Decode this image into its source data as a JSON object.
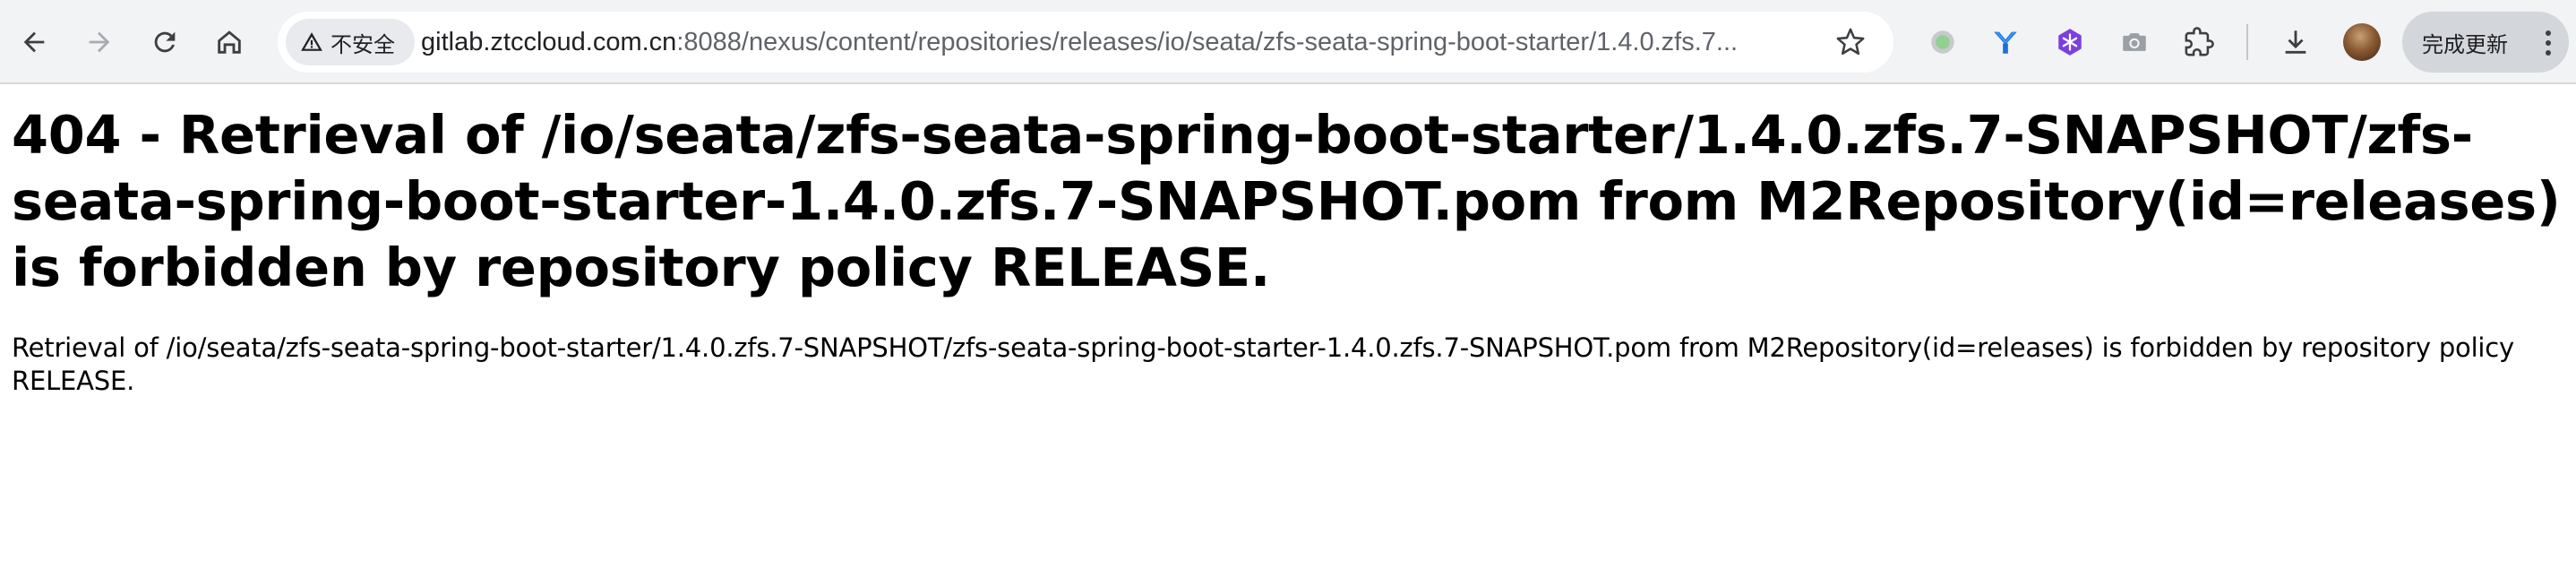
{
  "browser": {
    "security_label": "不安全",
    "url_host": "gitlab.ztccloud.com.cn",
    "url_rest": ":8088/nexus/content/repositories/releases/io/seata/zfs-seata-spring-boot-starter/1.4.0.zfs.7...",
    "update_label": "完成更新",
    "icons": {
      "back": "back-arrow-icon",
      "forward": "forward-arrow-icon",
      "reload": "reload-icon",
      "home": "home-icon",
      "warning": "warning-triangle-icon",
      "bookmark": "star-icon",
      "extensions": [
        "green-dot-extension-icon",
        "y-logo-extension-icon",
        "purple-snowflake-extension-icon",
        "camera-extension-icon",
        "puzzle-extensions-icon"
      ],
      "download": "download-icon",
      "menu": "kebab-menu-icon"
    }
  },
  "page": {
    "heading": "404 - Retrieval of /io/seata/zfs-seata-spring-boot-starter/1.4.0.zfs.7-SNAPSHOT/zfs-seata-spring-boot-starter-1.4.0.zfs.7-SNAPSHOT.pom from M2Repository(id=releases) is forbidden by repository policy RELEASE.",
    "message": "Retrieval of /io/seata/zfs-seata-spring-boot-starter/1.4.0.zfs.7-SNAPSHOT/zfs-seata-spring-boot-starter-1.4.0.zfs.7-SNAPSHOT.pom from M2Repository(id=releases) is forbidden by repository policy RELEASE."
  }
}
